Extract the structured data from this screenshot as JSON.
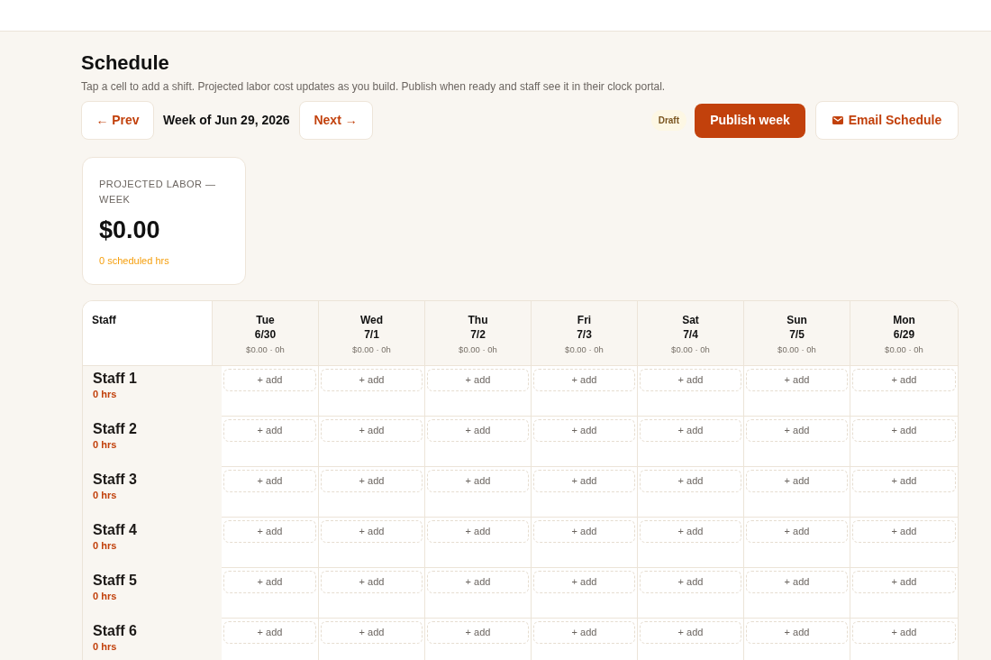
{
  "page": {
    "title": "Schedule",
    "subtitle": "Tap a cell to add a shift. Projected labor cost updates as you build. Publish when ready and staff see it in their clock portal."
  },
  "week_nav": {
    "prev": "← Prev",
    "label": "Week of Jun 29, 2026",
    "next": "Next →"
  },
  "actions": {
    "status": "Draft",
    "publish": "Publish week",
    "email": "Email Schedule"
  },
  "summary_card": {
    "label": "PROJECTED LABOR — WEEK",
    "value": "$0.00",
    "hours": "0 scheduled hrs"
  },
  "table": {
    "staff_heading": "Staff",
    "days": [
      {
        "day": "Tue",
        "date": "6/30",
        "totals": "$0.00 · 0h"
      },
      {
        "day": "Wed",
        "date": "7/1",
        "totals": "$0.00 · 0h"
      },
      {
        "day": "Thu",
        "date": "7/2",
        "totals": "$0.00 · 0h"
      },
      {
        "day": "Fri",
        "date": "7/3",
        "totals": "$0.00 · 0h"
      },
      {
        "day": "Sat",
        "date": "7/4",
        "totals": "$0.00 · 0h"
      },
      {
        "day": "Sun",
        "date": "7/5",
        "totals": "$0.00 · 0h"
      },
      {
        "day": "Mon",
        "date": "6/29",
        "totals": "$0.00 · 0h"
      }
    ],
    "rows": [
      {
        "name": "Staff 1",
        "hours": "0 hrs",
        "cells": [
          "+ add",
          "+ add",
          "+ add",
          "+ add",
          "+ add",
          "+ add",
          "+ add"
        ]
      },
      {
        "name": "Staff 2",
        "hours": "0 hrs",
        "cells": [
          "+ add",
          "+ add",
          "+ add",
          "+ add",
          "+ add",
          "+ add",
          "+ add"
        ]
      },
      {
        "name": "Staff 3",
        "hours": "0 hrs",
        "cells": [
          "+ add",
          "+ add",
          "+ add",
          "+ add",
          "+ add",
          "+ add",
          "+ add"
        ]
      },
      {
        "name": "Staff 4",
        "hours": "0 hrs",
        "cells": [
          "+ add",
          "+ add",
          "+ add",
          "+ add",
          "+ add",
          "+ add",
          "+ add"
        ]
      },
      {
        "name": "Staff 5",
        "hours": "0 hrs",
        "cells": [
          "+ add",
          "+ add",
          "+ add",
          "+ add",
          "+ add",
          "+ add",
          "+ add"
        ]
      },
      {
        "name": "Staff 6",
        "hours": "0 hrs",
        "cells": [
          "+ add",
          "+ add",
          "+ add",
          "+ add",
          "+ add",
          "+ add",
          "+ add"
        ]
      }
    ]
  }
}
